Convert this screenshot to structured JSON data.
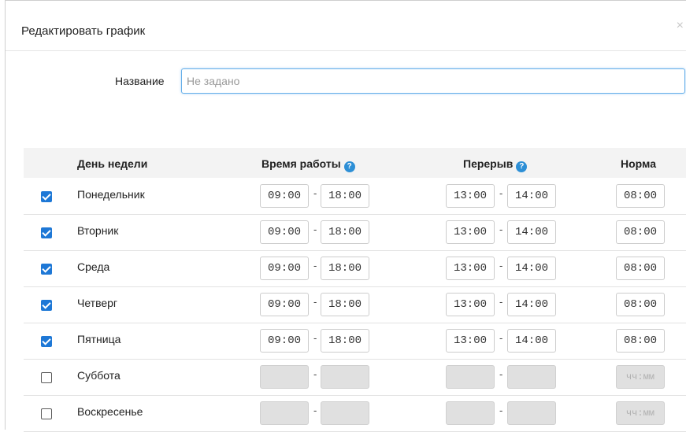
{
  "dialog": {
    "title": "Редактировать график",
    "close_label": "×"
  },
  "name_field": {
    "label": "Название",
    "placeholder": "Не задано",
    "value": ""
  },
  "table": {
    "headers": {
      "day": "День недели",
      "work_time": "Время работы",
      "break": "Перерыв",
      "norm": "Норма"
    },
    "help_glyph": "?",
    "separator": "-",
    "norm_placeholder": "чч:мм",
    "rows": [
      {
        "day": "Понедельник",
        "checked": true,
        "work_start": "09:00",
        "work_end": "18:00",
        "break_start": "13:00",
        "break_end": "14:00",
        "norm": "08:00"
      },
      {
        "day": "Вторник",
        "checked": true,
        "work_start": "09:00",
        "work_end": "18:00",
        "break_start": "13:00",
        "break_end": "14:00",
        "norm": "08:00"
      },
      {
        "day": "Среда",
        "checked": true,
        "work_start": "09:00",
        "work_end": "18:00",
        "break_start": "13:00",
        "break_end": "14:00",
        "norm": "08:00"
      },
      {
        "day": "Четверг",
        "checked": true,
        "work_start": "09:00",
        "work_end": "18:00",
        "break_start": "13:00",
        "break_end": "14:00",
        "norm": "08:00"
      },
      {
        "day": "Пятница",
        "checked": true,
        "work_start": "09:00",
        "work_end": "18:00",
        "break_start": "13:00",
        "break_end": "14:00",
        "norm": "08:00"
      },
      {
        "day": "Суббота",
        "checked": false,
        "work_start": "",
        "work_end": "",
        "break_start": "",
        "break_end": "",
        "norm": ""
      },
      {
        "day": "Воскресенье",
        "checked": false,
        "work_start": "",
        "work_end": "",
        "break_start": "",
        "break_end": "",
        "norm": ""
      }
    ]
  },
  "colors": {
    "accent": "#1e78d6",
    "help_icon": "#2d8fd6",
    "focus_border": "#66afe9",
    "disabled_input": "#e0e0e0",
    "header_bg": "#f3f3f3"
  }
}
